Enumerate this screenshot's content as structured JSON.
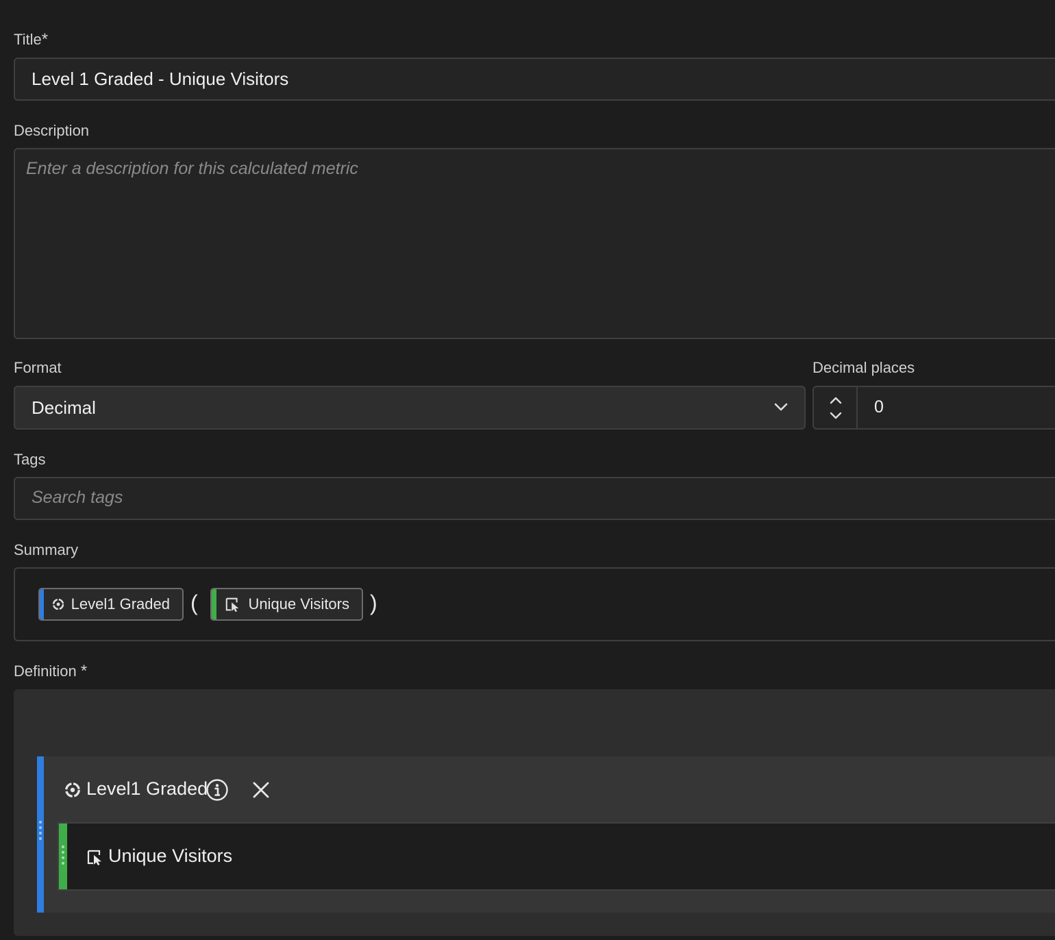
{
  "title": {
    "label": "Title",
    "required_mark": "*",
    "value": "Level 1 Graded - Unique Visitors"
  },
  "description": {
    "label": "Description",
    "placeholder": "Enter a description for this calculated metric"
  },
  "format": {
    "label": "Format",
    "value": "Decimal"
  },
  "decimal_places": {
    "label": "Decimal places",
    "value": "0"
  },
  "tags": {
    "label": "Tags",
    "placeholder": "Search tags"
  },
  "summary": {
    "label": "Summary",
    "function_pill": "Level1 Graded",
    "open_paren": "(",
    "metric_pill": "Unique Visitors",
    "close_paren": ")"
  },
  "definition": {
    "label": "Definition",
    "required_mark": "*",
    "function_name": "Level1 Graded",
    "metric_name": "Unique Visitors"
  },
  "colors": {
    "function_accent": "#2f7de1",
    "metric_accent": "#3fae49"
  },
  "icons": {
    "function": "segment-function-icon",
    "metric": "metric-cursor-icon",
    "info": "info-icon",
    "close": "close-icon",
    "dropdown": "chevron-down-icon",
    "stepper": "stepper-icon"
  }
}
